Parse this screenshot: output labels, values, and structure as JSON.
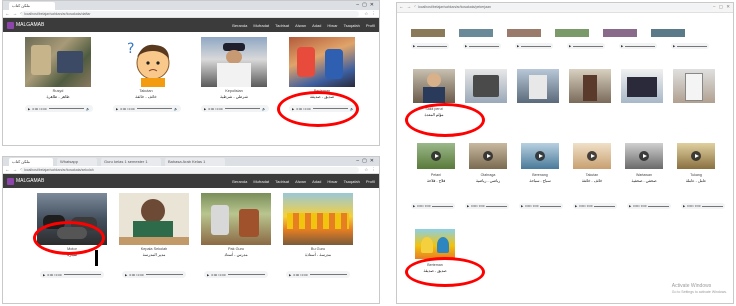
{
  "colors": {
    "brand": "#8e44ad",
    "annotation": "#ff0000",
    "nav_bg": "#3b3b3b"
  },
  "top_left": {
    "tab": "ملكن كتاب",
    "url": "localhost/belajar/sahkan/ar/kosakata/daftar",
    "site_name": "MALGAMAB",
    "menu": [
      "Beranda",
      "Mufradat",
      "Tadrisat",
      "Alwan",
      "Adad",
      "Hiwar",
      "Tsaqafah",
      "Profil"
    ],
    "cards": [
      {
        "en": "Rusyd",
        "ar": "ظاهر - ظاهرة"
      },
      {
        "en": "Takutan",
        "ar": "خائف - خائفة"
      },
      {
        "en": "Kepolisian",
        "ar": "شرطي - شرطية"
      },
      {
        "en": "Berteman",
        "ar": "صديق - صديقة"
      }
    ],
    "player_time": "0:00 / 0:00"
  },
  "bottom_left": {
    "tabs": [
      "ملكن كتاب",
      "Whatsapp",
      "Guru kelas 1 semester 1",
      "Bahasa Arab Kelas 1"
    ],
    "url": "localhost/belajar/sahkan/ar/kosakata/sekolah",
    "site_name": "MALGAMAB",
    "menu": [
      "Beranda",
      "Mufradat",
      "Tadrisat",
      "Alwan",
      "Adad",
      "Hiwar",
      "Tsaqafah",
      "Profil"
    ],
    "cards": [
      {
        "en": "Motor",
        "ar": "سيارة"
      },
      {
        "en": "Kepala Sekolah",
        "ar": "مدير المدرسة"
      },
      {
        "en": "Pak Guru",
        "ar": "مدرس - أستاذ"
      },
      {
        "en": "Bu Guru",
        "ar": "مدرسة - أستاذة"
      }
    ],
    "player_time": "0:00 / 0:00"
  },
  "right": {
    "url": "localhost/belajar/sahkan/ar/kosakata/pekerjaan",
    "row2_captions": [
      {
        "en": "Sakit perut",
        "ar": "مؤلم المعدة"
      }
    ],
    "row3_captions": [
      {
        "en": "Petani",
        "ar": "فلاح - فلاحة"
      },
      {
        "en": "Olahraga",
        "ar": "رياضي - رياضية"
      },
      {
        "en": "Berenang",
        "ar": "سباح - سباحة"
      },
      {
        "en": "Takutan",
        "ar": "خائف - خائفة"
      },
      {
        "en": "Wartawan",
        "ar": "صحفي - صحفية"
      },
      {
        "en": "Tukang",
        "ar": "عامل - عاملة"
      }
    ],
    "last_caption": {
      "en": "Berteman",
      "ar": "صديق - صديقة"
    },
    "player_time": "0:00 / 0:00",
    "watermark_line1": "Activate Windows",
    "watermark_line2": "Go to Settings to activate Windows."
  }
}
